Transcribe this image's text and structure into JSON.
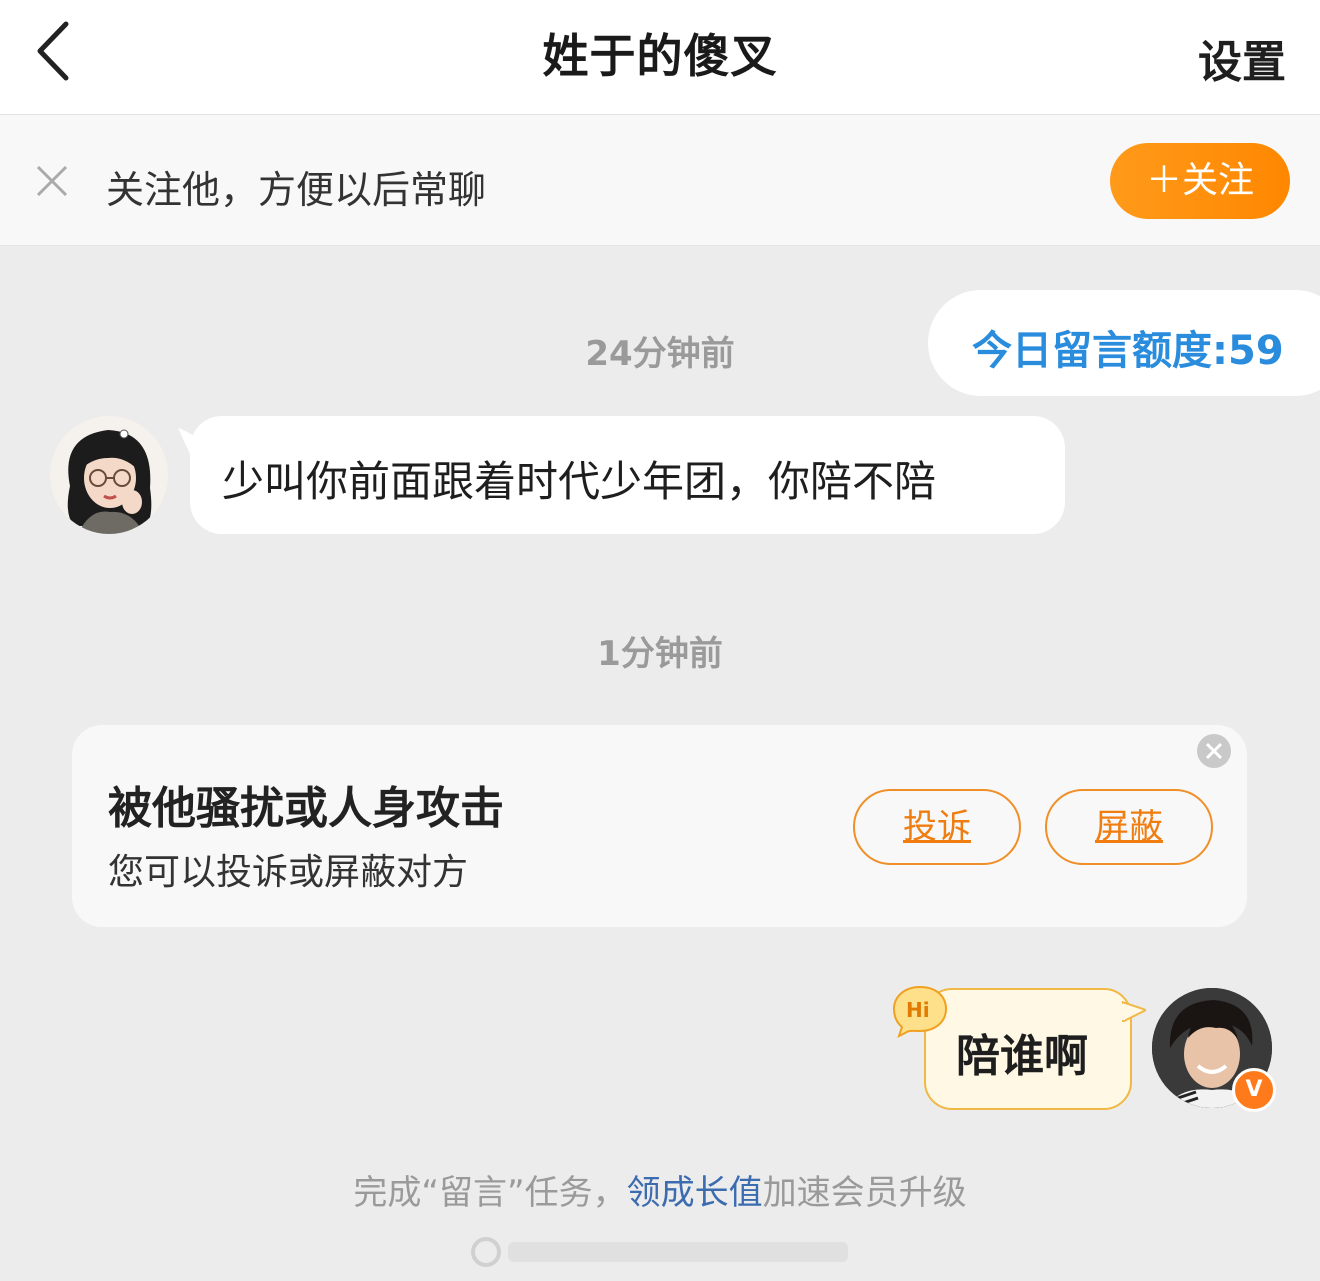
{
  "header": {
    "back_icon": "chevron-left-icon",
    "title": "姓于的傻叉",
    "settings_label": "设置"
  },
  "follow_bar": {
    "close_icon": "close-icon",
    "text": "关注他，方便以后常聊",
    "button_label": "＋关注"
  },
  "quota": {
    "text": "今日留言额度:59"
  },
  "messages": [
    {
      "timestamp": "24分钟前",
      "sender": "other",
      "text": "少叫你前面跟着时代少年团，你陪不陪"
    },
    {
      "timestamp": "1分钟前",
      "sender": "me",
      "text": "陪谁啊",
      "badge": "Hi"
    }
  ],
  "safety_card": {
    "title": "被他骚扰或人身攻击",
    "subtitle": "您可以投诉或屏蔽对方",
    "report_label": "投诉",
    "block_label": "屏蔽"
  },
  "footer": {
    "prefix": "完成“留言”任务，",
    "link": "领成长值",
    "suffix": "加速会员升级"
  },
  "verified_badge": "V",
  "colors": {
    "accent_orange": "#ff8c00",
    "quota_blue": "#2a8cdc",
    "link_blue": "#3c6cb0",
    "bubble_yellow": "#fff8e5"
  }
}
